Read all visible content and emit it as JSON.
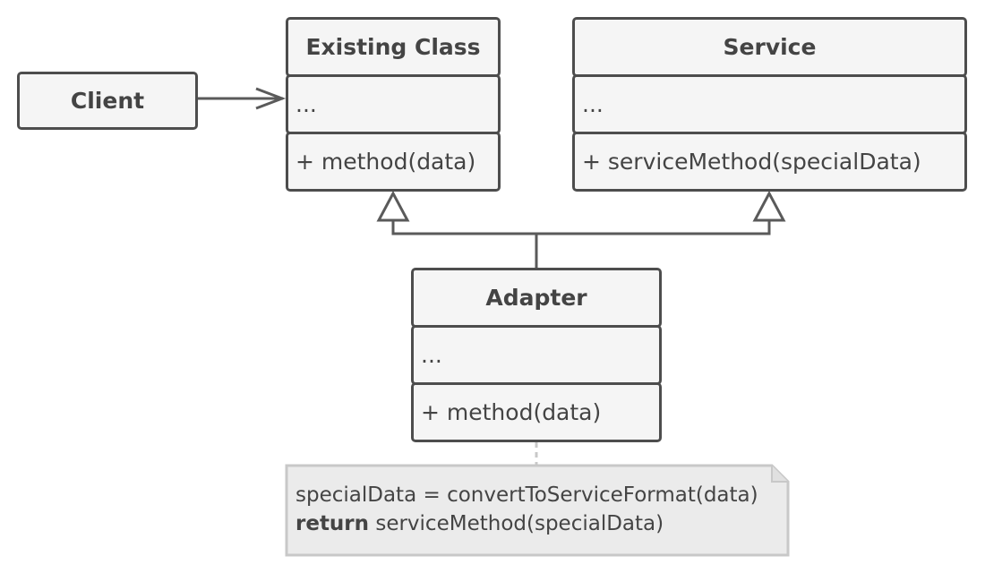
{
  "client": {
    "name": "Client"
  },
  "existing_class": {
    "name": "Existing Class",
    "fields": "...",
    "methods": "+ method(data)"
  },
  "service": {
    "name": "Service",
    "fields": "...",
    "methods": "+ serviceMethod(specialData)"
  },
  "adapter": {
    "name": "Adapter",
    "fields": "...",
    "methods": "+ method(data)"
  },
  "note": {
    "line1": "specialData = convertToServiceFormat(data)",
    "line2_keyword": "return",
    "line2_rest": " serviceMethod(specialData)"
  },
  "colors": {
    "stroke": "#4d4d4d",
    "fill": "#f5f5f5",
    "note_fill": "#ebebeb",
    "note_stroke": "#c8c8c8"
  }
}
